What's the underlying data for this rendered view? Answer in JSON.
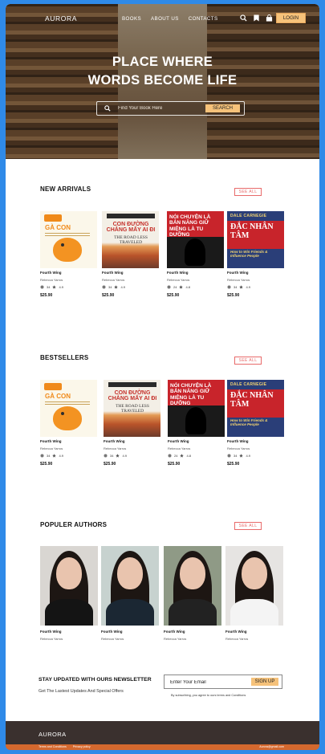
{
  "nav": {
    "brand": "AURORA",
    "links": [
      "BOOKS",
      "ABOUT US",
      "CONTACTS"
    ],
    "login": "LOGIN"
  },
  "hero": {
    "title_line1": "PLACE WHERE",
    "title_line2": "WORDS BECOME LIFE",
    "search_placeholder": "Find Your Book Here",
    "search_button": "SEARCH"
  },
  "new_arrivals": {
    "title": "NEW ARRIVALS",
    "see_all": "SEE ALL",
    "books": [
      {
        "title": "Fourth Wing",
        "author": "Rebecca Yarros",
        "count": "34",
        "rating": "4.9",
        "price": "$25.90",
        "cover": {
          "tag": "Kiến thức",
          "title": "GÀ CON"
        }
      },
      {
        "title": "Fourth Wing",
        "author": "Rebecca Yarros",
        "count": "34",
        "rating": "4.9",
        "price": "$25.90",
        "cover": {
          "author": "M. Scott Peck",
          "title": "CON ĐƯỜNG CHẲNG MẤY AI ĐI",
          "subtitle": "THE ROAD LESS TRAVELED"
        }
      },
      {
        "title": "Fourth Wing",
        "author": "Rebecca Yarros",
        "count": "24",
        "rating": "4.8",
        "price": "$25.90",
        "cover": {
          "title": "NÓI CHUYỆN LÀ BẢN NĂNG GIỮ MIỆNG LÀ TU DƯỠNG",
          "subtitle": "IM LẶNG LÀ TRÍ TUỆ"
        }
      },
      {
        "title": "Fourth Wing",
        "author": "Rebecca Yarros",
        "count": "34",
        "rating": "4.9",
        "price": "$25.90",
        "cover": {
          "author": "DALE CARNEGIE",
          "title": "ĐẮC NHÂN TÂM",
          "subtitle": "How to Win Friends & Influence People"
        }
      }
    ]
  },
  "bestsellers": {
    "title": "BESTSELLERS",
    "see_all": "SEE ALL",
    "books": [
      {
        "title": "Fourth Wing",
        "author": "Rebecca Yarros",
        "count": "34",
        "rating": "4.9",
        "price": "$25.90",
        "cover": {
          "tag": "Kiến thức",
          "title": "GÀ CON"
        }
      },
      {
        "title": "Fourth Wing",
        "author": "Rebecca Yarros",
        "count": "34",
        "rating": "4.9",
        "price": "$25.90",
        "cover": {
          "author": "M. Scott Peck",
          "title": "CON ĐƯỜNG CHẲNG MẤY AI ĐI",
          "subtitle": "THE ROAD LESS TRAVELED"
        }
      },
      {
        "title": "Fourth Wing",
        "author": "Rebecca Yarros",
        "count": "24",
        "rating": "4.8",
        "price": "$25.90",
        "cover": {
          "title": "NÓI CHUYỆN LÀ BẢN NĂNG GIỮ MIỆNG LÀ TU DƯỠNG",
          "subtitle": "IM LẶNG LÀ TRÍ TUỆ"
        }
      },
      {
        "title": "Fourth Wing",
        "author": "Rebecca Yarros",
        "count": "34",
        "rating": "4.9",
        "price": "$25.90",
        "cover": {
          "author": "DALE CARNEGIE",
          "title": "ĐẮC NHÂN TÂM",
          "subtitle": "How to Win Friends & Influence People"
        }
      }
    ]
  },
  "authors": {
    "title": "POPULER AUTHORS",
    "see_all": "SEE ALL",
    "items": [
      {
        "name": "Fourth Wing",
        "sub": "Rebecca Yarros"
      },
      {
        "name": "Fourth Wing",
        "sub": "Rebecca Yarros"
      },
      {
        "name": "Fourth Wing",
        "sub": "Rebecca Yarros"
      },
      {
        "name": "Fourth Wing",
        "sub": "Rebecca Yarros"
      }
    ]
  },
  "newsletter": {
    "title": "STAY UPDATED WITH OURS NEWSLETTER",
    "subtitle": "Get The Lastest Updates And Special Offers",
    "placeholder": "Enter Your Email",
    "button": "SIGN UP",
    "note": "By subscribing, you agree to ours terms and Conditions"
  },
  "footer": {
    "brand": "AURORA",
    "links": [
      "Terms and Conditions",
      "Privacy policy"
    ],
    "email": "Aurora@gmail.com"
  },
  "colors": {
    "accent": "#f6c27a",
    "see_all": "#e86a6a",
    "footer_bg": "#3a302e",
    "footer_bar": "#d4682e",
    "frame": "#2f8ae8"
  }
}
